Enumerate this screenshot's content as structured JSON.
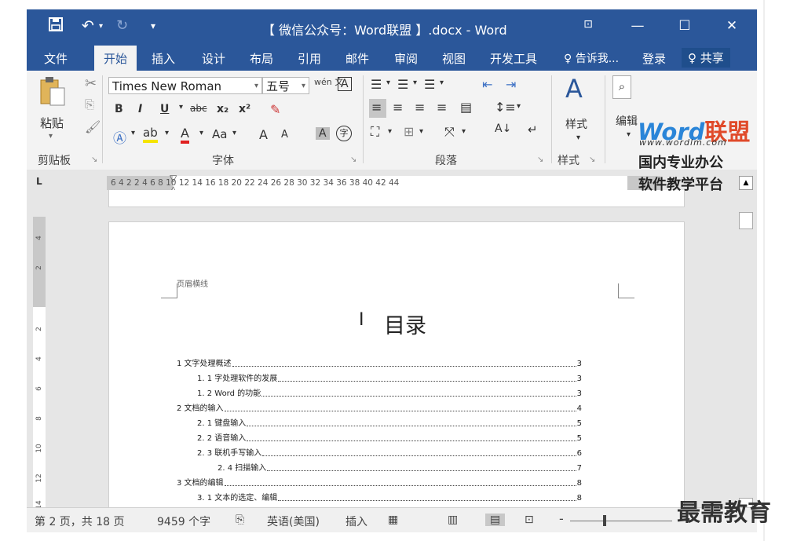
{
  "window": {
    "title": "【 微信公众号：Word联盟 】.docx - Word",
    "quick_access": {
      "save_icon": "save-icon",
      "undo_icon": "undo-icon",
      "redo_icon": "redo-icon",
      "customize_icon": "customize-qat-icon"
    },
    "controls": {
      "ribbon_display": "⊡",
      "minimize": "—",
      "maximize": "☐",
      "close": "✕"
    }
  },
  "tabs": [
    {
      "label": "文件"
    },
    {
      "label": "开始"
    },
    {
      "label": "插入"
    },
    {
      "label": "设计"
    },
    {
      "label": "布局"
    },
    {
      "label": "引用"
    },
    {
      "label": "邮件"
    },
    {
      "label": "审阅"
    },
    {
      "label": "视图"
    },
    {
      "label": "开发工具"
    }
  ],
  "tell_me": "♀ 告诉我...",
  "sign_in": "登录",
  "share": "♀ 共享",
  "ribbon": {
    "clipboard": {
      "label": "剪贴板",
      "paste": "粘贴"
    },
    "font": {
      "label": "字体",
      "font_name": "Times New Roman",
      "font_size": "五号",
      "bold": "B",
      "italic": "I",
      "underline": "U",
      "strike": "abc",
      "sub": "x₂",
      "sup": "x²",
      "case": "Aa",
      "grow": "A",
      "shrink": "A",
      "phonetic": "wén 文",
      "border_char": "A",
      "circle_char": "字"
    },
    "paragraph": {
      "label": "段落"
    },
    "styles": {
      "label": "样式",
      "styles_btn": "样式"
    },
    "editing": {
      "label": "编辑"
    }
  },
  "ruler": {
    "ticks": "6  4  2     2  4  6  8  10  12  14  16  18  20  22  24  26  28  30  32  34  36  38  40  42  44"
  },
  "vruler_ticks": [
    "4",
    "2",
    "2",
    "4",
    "6",
    "8",
    "10",
    "12",
    "14"
  ],
  "document": {
    "header_note": "页眉横线",
    "toc_title": "目录",
    "toc": [
      {
        "text": "1 文字处理概述",
        "page": "3",
        "level": 1
      },
      {
        "text": "1. 1  字处理软件的发展",
        "page": "3",
        "level": 2
      },
      {
        "text": "1. 2  Word  的功能",
        "page": "3",
        "level": 2
      },
      {
        "text": "2 文档的输入",
        "page": "4",
        "level": 1
      },
      {
        "text": "2. 1 键盘输入",
        "page": "5",
        "level": 2
      },
      {
        "text": "2. 2 语音输入",
        "page": "5",
        "level": 2
      },
      {
        "text": "2. 3 联机手写输入",
        "page": "6",
        "level": 2
      },
      {
        "text": "2. 4 扫描输入",
        "page": "7",
        "level": 3
      },
      {
        "text": "3 文档的编辑",
        "page": "8",
        "level": 1
      },
      {
        "text": "3. 1  文本的选定、编辑",
        "page": "8",
        "level": 2
      }
    ]
  },
  "status": {
    "page": "第 2 页，共 18 页",
    "words": "9459 个字",
    "language": "英语(美国)",
    "mode": "插入"
  },
  "watermarks": {
    "logo_word": "Word",
    "logo_red": "联盟",
    "url": "www.wordlm.com",
    "line1": "国内专业办公",
    "line2": "软件教学平台",
    "bottom": "最需教育"
  },
  "colors": {
    "accent": "#2b579a",
    "ribbon_bg": "#f3f3f3"
  }
}
